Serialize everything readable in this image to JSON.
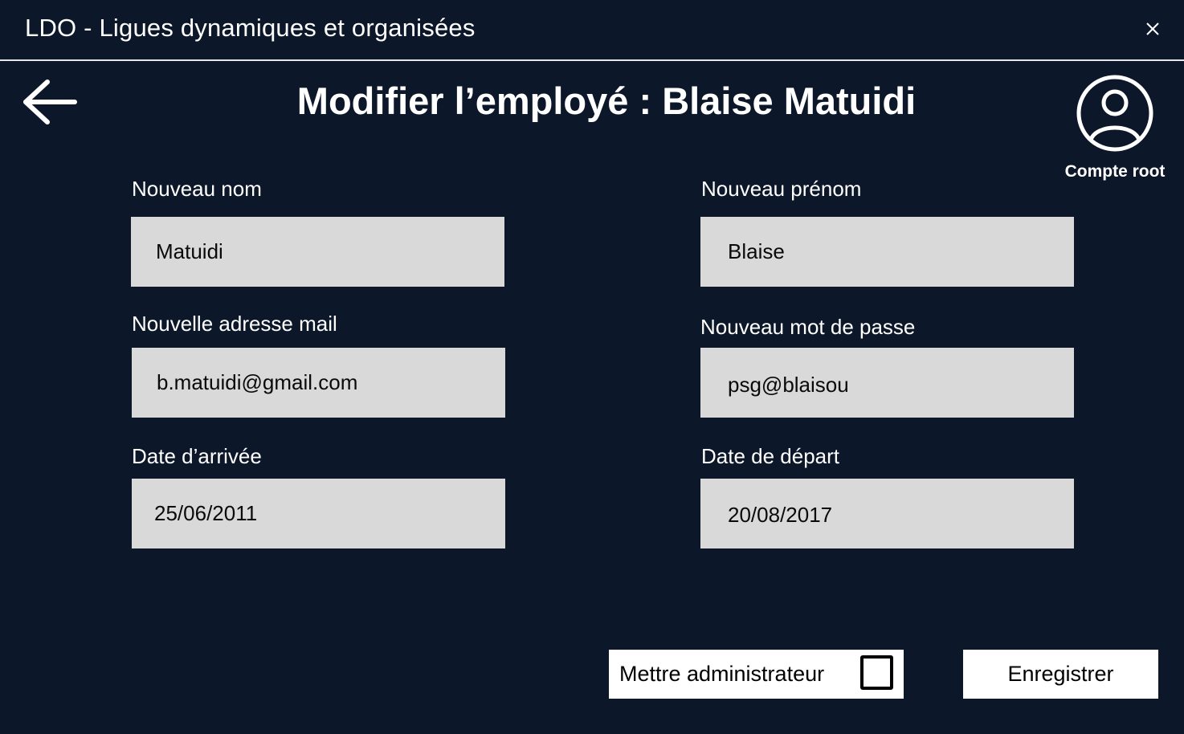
{
  "app": {
    "title": "LDO - Ligues dynamiques et organisées",
    "close_icon": "close-icon",
    "back_icon": "arrow-left-icon"
  },
  "page": {
    "title": "Modifier l’employé : Blaise Matuidi"
  },
  "account": {
    "icon": "user-avatar-icon",
    "label": "Compte root"
  },
  "form": {
    "last_name": {
      "label": "Nouveau nom",
      "value": "Matuidi"
    },
    "first_name": {
      "label": "Nouveau prénom",
      "value": "Blaise"
    },
    "email": {
      "label": "Nouvelle adresse mail",
      "value": "b.matuidi@gmail.com"
    },
    "password": {
      "label": "Nouveau mot de passe",
      "value": "psg@blaisou"
    },
    "arrival_date": {
      "label": "Date d’arrivée",
      "value": "25/06/2011"
    },
    "departure_date": {
      "label": "Date de départ",
      "value": "20/08/2017"
    }
  },
  "actions": {
    "admin_label": "Mettre administrateur",
    "admin_checked": false,
    "save_label": "Enregistrer"
  },
  "colors": {
    "background": "#0d172a",
    "input_background": "#d9d9d9",
    "text": "#ffffff"
  }
}
